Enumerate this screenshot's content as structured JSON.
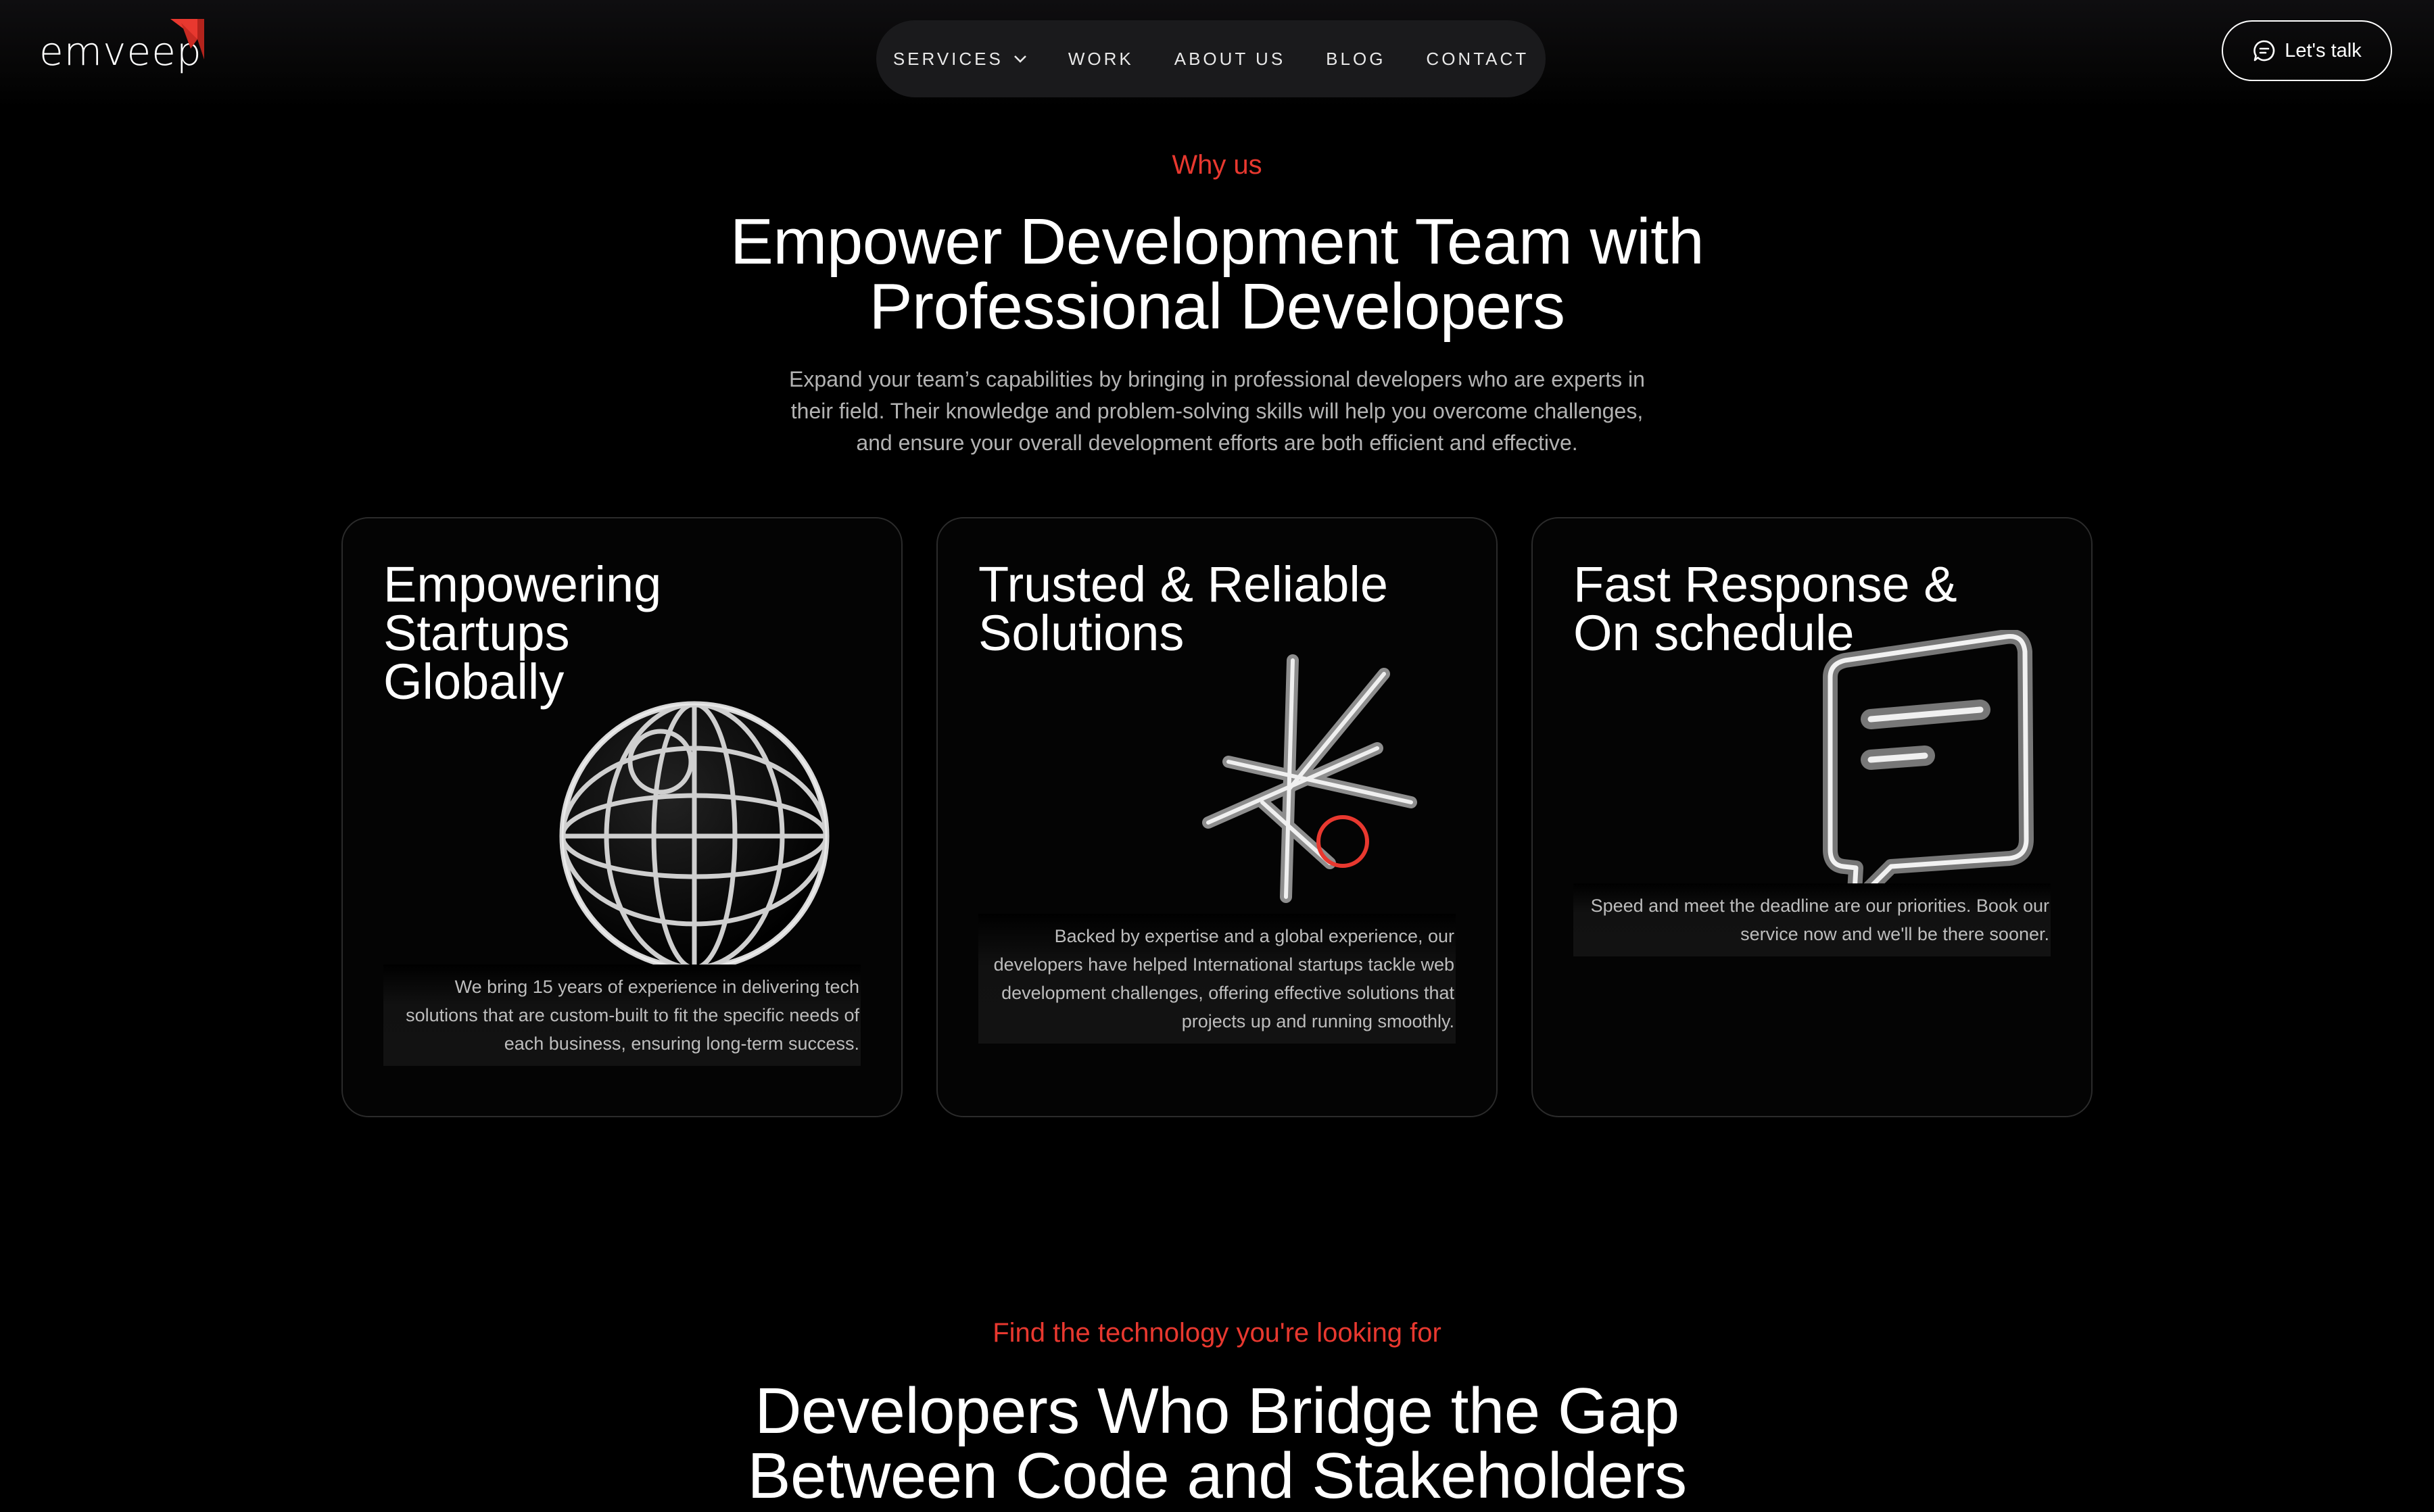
{
  "header": {
    "logo_text": "emveep",
    "brand_color": "#e8382f",
    "nav": [
      {
        "label": "SERVICES",
        "has_dropdown": true
      },
      {
        "label": "WORK"
      },
      {
        "label": "ABOUT US"
      },
      {
        "label": "BLOG"
      },
      {
        "label": "CONTACT"
      }
    ],
    "cta_label": "Let's talk",
    "cta_icon": "chat-bubble-icon"
  },
  "why_us": {
    "eyebrow": "Why us",
    "title_line1": "Empower Development Team with",
    "title_line2": "Professional Developers",
    "description": "Expand your team’s capabilities by bringing in professional developers who are experts in their field. Their knowledge and problem-solving skills will help you overcome challenges, and ensure your overall development efforts are both efficient and effective.",
    "cards": [
      {
        "title_lines": [
          "Empowering",
          "Startups",
          "Globally"
        ],
        "icon": "globe-icon",
        "description": "We bring 15 years of experience in delivering tech solutions that are custom-built to fit the specific needs of each business, ensuring long-term success."
      },
      {
        "title_lines": [
          "Trusted & Reliable",
          "Solutions"
        ],
        "icon": "star-burst-icon",
        "description": "Backed by expertise and a global experience, our developers have helped International startups tackle web development challenges, offering effective solutions that projects up and running smoothly."
      },
      {
        "title_lines": [
          "Fast Response &",
          "On schedule"
        ],
        "icon": "message-bubble-icon",
        "description": "Speed and meet the deadline are our priorities. Book our service now and we'll be there sooner."
      }
    ]
  },
  "technology": {
    "eyebrow": "Find the technology you're looking for",
    "title_line1": "Developers Who Bridge the Gap",
    "title_line2": "Between Code and Stakeholders"
  }
}
